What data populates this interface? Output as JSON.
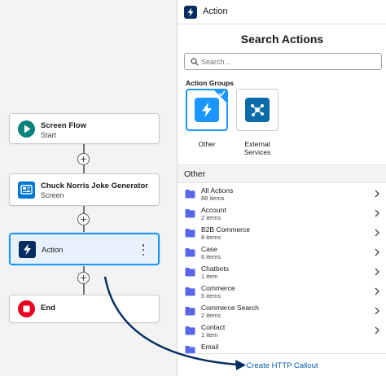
{
  "flow": {
    "elements": [
      {
        "title": "Screen Flow",
        "subtitle": "Start",
        "icon": "play-icon",
        "color": "#0b827c"
      },
      {
        "title": "Chuck Norris Joke Generator",
        "subtitle": "Screen",
        "icon": "screen-icon",
        "color": "#0176d3"
      },
      {
        "label": "Action",
        "icon": "bolt-icon",
        "color": "#032d60"
      },
      {
        "label": "End",
        "icon": "stop-icon",
        "color": "#ea001e"
      }
    ]
  },
  "panel": {
    "header_title": "Action",
    "search_title": "Search Actions",
    "search_placeholder": "Search...",
    "groups_label": "Action Groups",
    "groups": [
      {
        "name": "Other",
        "icon": "bolt-icon",
        "color": "#1b96ff",
        "selected": true
      },
      {
        "name": "External Services",
        "icon": "network-icon",
        "color": "#0b6aa8",
        "selected": false
      }
    ],
    "section_label": "Other",
    "items": [
      {
        "title": "All Actions",
        "count": "88 items"
      },
      {
        "title": "Account",
        "count": "2 items"
      },
      {
        "title": "B2B Commerce",
        "count": "8 items"
      },
      {
        "title": "Case",
        "count": "6 items"
      },
      {
        "title": "Chatbots",
        "count": "1 item"
      },
      {
        "title": "Commerce",
        "count": "5 items"
      },
      {
        "title": "Commerce Search",
        "count": "2 items"
      },
      {
        "title": "Contact",
        "count": "1 item"
      },
      {
        "title": "Email",
        "count": ""
      }
    ],
    "footer_link": "Create HTTP Callout"
  },
  "colors": {
    "accent": "#1b96ff",
    "folder": "#5867e8",
    "link": "#0b5cab",
    "annotation_arrow": "#032d60"
  }
}
